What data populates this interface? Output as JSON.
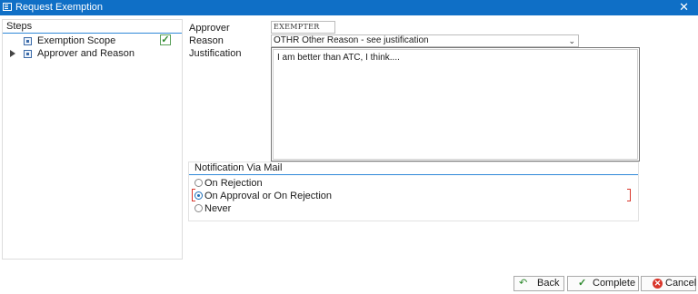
{
  "window": {
    "title": "Request Exemption",
    "close_glyph": "✕"
  },
  "steps": {
    "header": "Steps",
    "items": [
      {
        "label": "Exemption Scope",
        "completed": true,
        "current": false
      },
      {
        "label": "Approver and Reason",
        "completed": false,
        "current": true
      }
    ]
  },
  "form": {
    "approver_label": "Approver",
    "approver_value": "EXEMPTER",
    "reason_label": "Reason",
    "reason_value": "OTHR Other Reason - see justification",
    "justification_label": "Justification",
    "justification_value": "I am better than ATC, I think...."
  },
  "notification": {
    "header": "Notification Via Mail",
    "options": [
      {
        "label": "On Rejection",
        "selected": false
      },
      {
        "label": "On Approval or On Rejection",
        "selected": true
      },
      {
        "label": "Never",
        "selected": false
      }
    ]
  },
  "buttons": {
    "back": "Back",
    "complete": "Complete",
    "cancel": "Cancel"
  },
  "colors": {
    "titlebar": "#0f6fc6",
    "accent": "#2f88d8",
    "check": "#2e8a2e",
    "cancel": "#d9362b"
  },
  "icons": {
    "window": "window-icon",
    "step": "step-icon",
    "completed": "checkmark-icon",
    "back": "back-arrow-icon",
    "complete": "checkmark-icon",
    "cancel": "cancel-icon"
  }
}
